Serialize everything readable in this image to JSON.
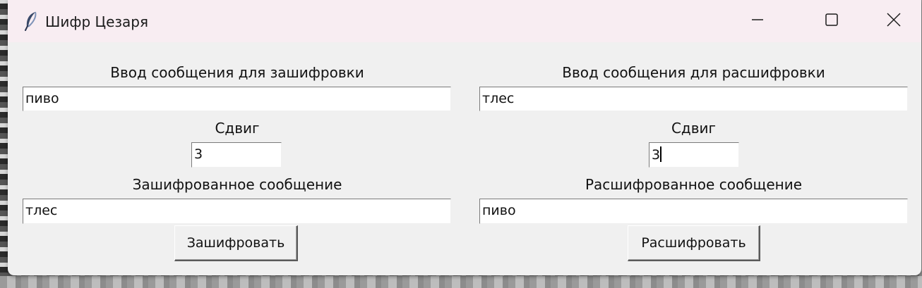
{
  "window": {
    "title": "Шифр Цезаря",
    "controls": {
      "minimize": "minimize-icon",
      "maximize": "maximize-icon",
      "close": "close-icon"
    }
  },
  "encrypt": {
    "input_label": "Ввод сообщения для зашифровки",
    "input_value": "пиво",
    "shift_label": "Сдвиг",
    "shift_value": "3",
    "output_label": "Зашифрованное сообщение",
    "output_value": "тлес",
    "button_label": "Зашифровать"
  },
  "decrypt": {
    "input_label": "Ввод сообщения для расшифровки",
    "input_value": "тлес",
    "shift_label": "Сдвиг",
    "shift_value": "3",
    "output_label": "Расшифрованное сообщение",
    "output_value": "пиво",
    "button_label": "Расшифровать"
  },
  "colors": {
    "titlebar": "#f8edf2",
    "window_bg": "#f0f0f0",
    "entry_bg": "#ffffff"
  }
}
